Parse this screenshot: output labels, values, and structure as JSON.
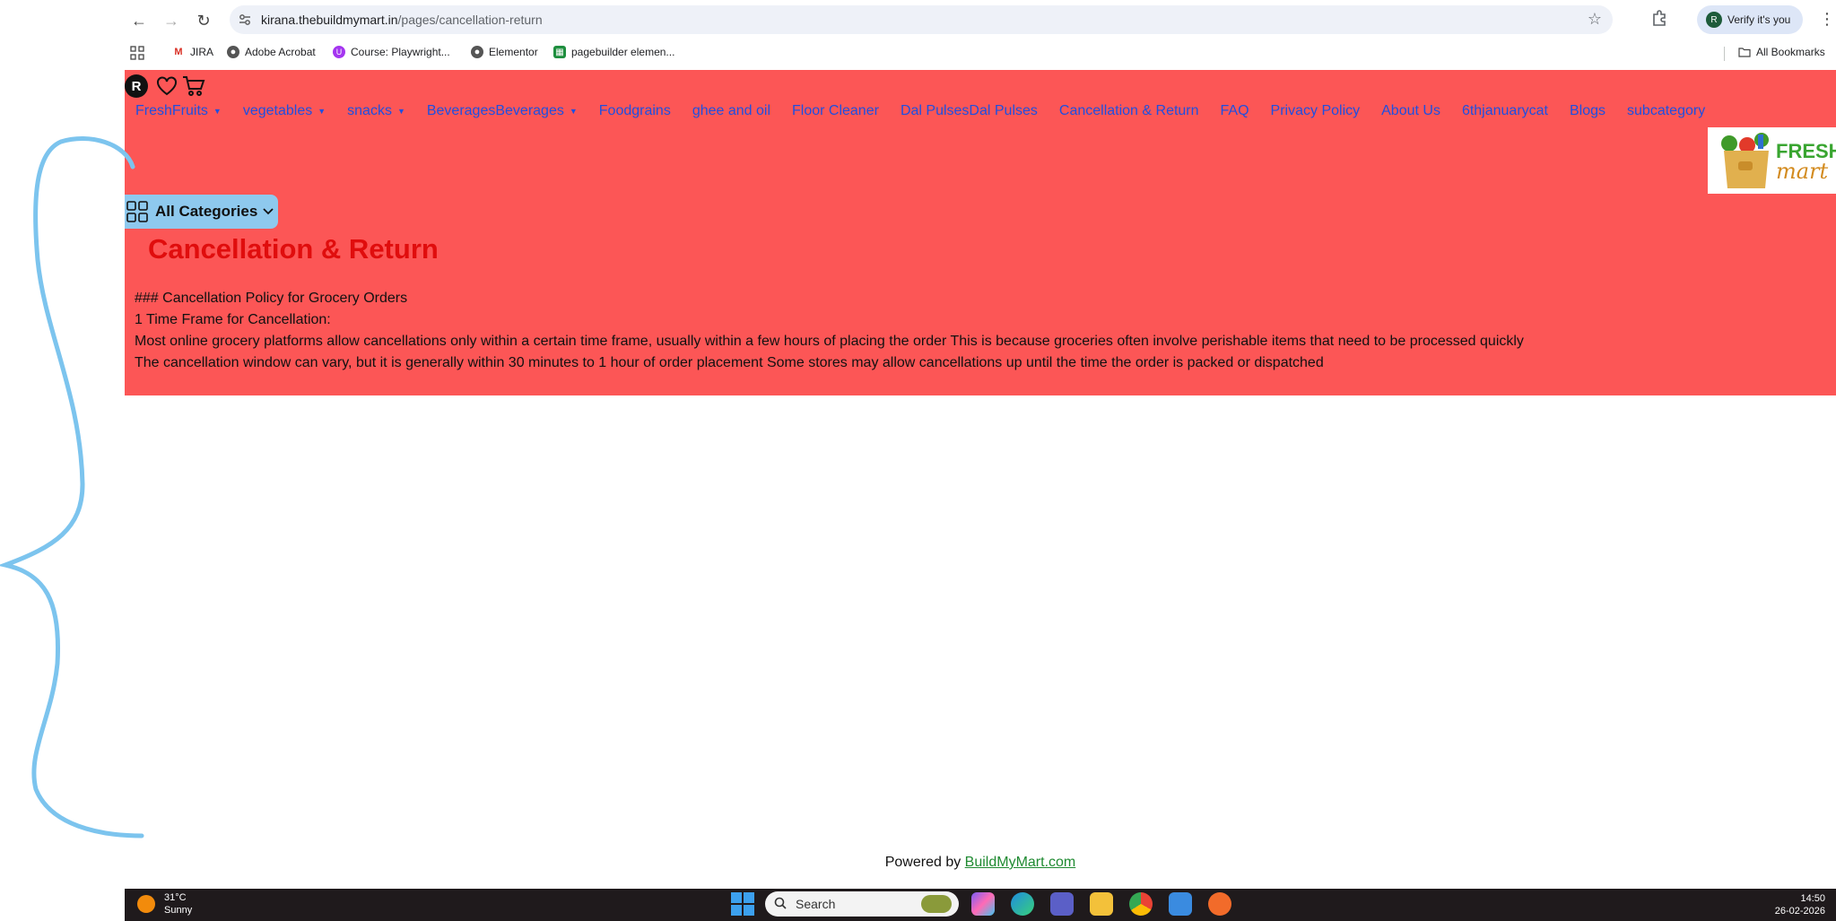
{
  "browser": {
    "url_host": "kirana.thebuildmymart.in",
    "url_path": "/pages/cancellation-return",
    "profile_badge": "Verify it's you",
    "profile_initial": "R"
  },
  "bookmarks": {
    "items": [
      {
        "label": "JIRA",
        "icon": "gmail-icon"
      },
      {
        "label": "Adobe Acrobat",
        "icon": "globe-icon"
      },
      {
        "label": "Course: Playwright...",
        "icon": "udemy-icon"
      },
      {
        "label": "Elementor",
        "icon": "globe-icon"
      },
      {
        "label": "pagebuilder elemen...",
        "icon": "sheets-icon"
      }
    ],
    "all_bookmarks": "All Bookmarks"
  },
  "site": {
    "user_initial": "R",
    "menu": [
      {
        "label": "FreshFruits",
        "has_dropdown": true
      },
      {
        "label": "vegetables",
        "has_dropdown": true
      },
      {
        "label": "snacks",
        "has_dropdown": true
      },
      {
        "label": "BeveragesBeverages",
        "has_dropdown": true
      },
      {
        "label": "Foodgrains",
        "has_dropdown": false
      },
      {
        "label": "ghee and oil",
        "has_dropdown": false
      },
      {
        "label": "Floor Cleaner",
        "has_dropdown": false
      },
      {
        "label": "Dal PulsesDal Pulses",
        "has_dropdown": false
      },
      {
        "label": "Cancellation & Return",
        "has_dropdown": false
      },
      {
        "label": "FAQ",
        "has_dropdown": false
      },
      {
        "label": "Privacy Policy",
        "has_dropdown": false
      },
      {
        "label": "About Us",
        "has_dropdown": false
      },
      {
        "label": "6thjanuarycat",
        "has_dropdown": false
      },
      {
        "label": "Blogs",
        "has_dropdown": false
      },
      {
        "label": "subcategory",
        "has_dropdown": false
      }
    ],
    "logo": {
      "line1": "FRESH",
      "line2": "mart"
    },
    "all_categories": "All Categories",
    "page_title": "Cancellation & Return",
    "content_lines": [
      "### Cancellation Policy for Grocery Orders",
      "1 Time Frame for Cancellation:",
      "Most online grocery platforms allow cancellations only within a certain time frame, usually within a few hours of placing the order This is because groceries often involve perishable items that need to be processed quickly",
      "The cancellation window can vary, but it is generally within 30 minutes to 1 hour of order placement Some stores may allow cancellations up until the time the order is packed or dispatched"
    ],
    "powered_prefix": "Powered by ",
    "powered_link": "BuildMyMart.com"
  },
  "colors": {
    "header_bg": "#fc5656",
    "menu_link": "#1f4fe0",
    "title": "#e00d0d",
    "all_categories_bg": "#8ec9ee",
    "annotation_stroke": "#7cc4ee"
  },
  "taskbar": {
    "weather_temp": "31°C",
    "weather_desc": "Sunny",
    "search_placeholder": "Search",
    "time": "14:50",
    "date": "26-02-2026"
  }
}
